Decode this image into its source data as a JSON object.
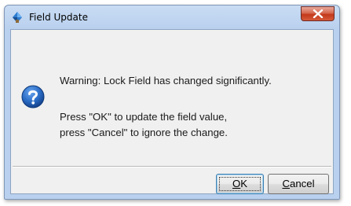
{
  "window": {
    "title": "Field Update",
    "icon": "app-icon",
    "close_icon": "close-x-icon"
  },
  "message": {
    "icon": "question-icon",
    "line1": "Warning: Lock Field has changed significantly.",
    "line2": "Press \"OK\" to update the field value,",
    "line3": "press \"Cancel\" to ignore the change."
  },
  "buttons": {
    "ok": {
      "mnemonic": "O",
      "rest": "K"
    },
    "cancel": {
      "mnemonic": "C",
      "rest": "ancel"
    }
  },
  "colors": {
    "titlebar": "#b9d0ee",
    "close_button": "#c4391c",
    "dialog_background": "#f0f0f0",
    "question_icon": "#1d5fb8"
  }
}
